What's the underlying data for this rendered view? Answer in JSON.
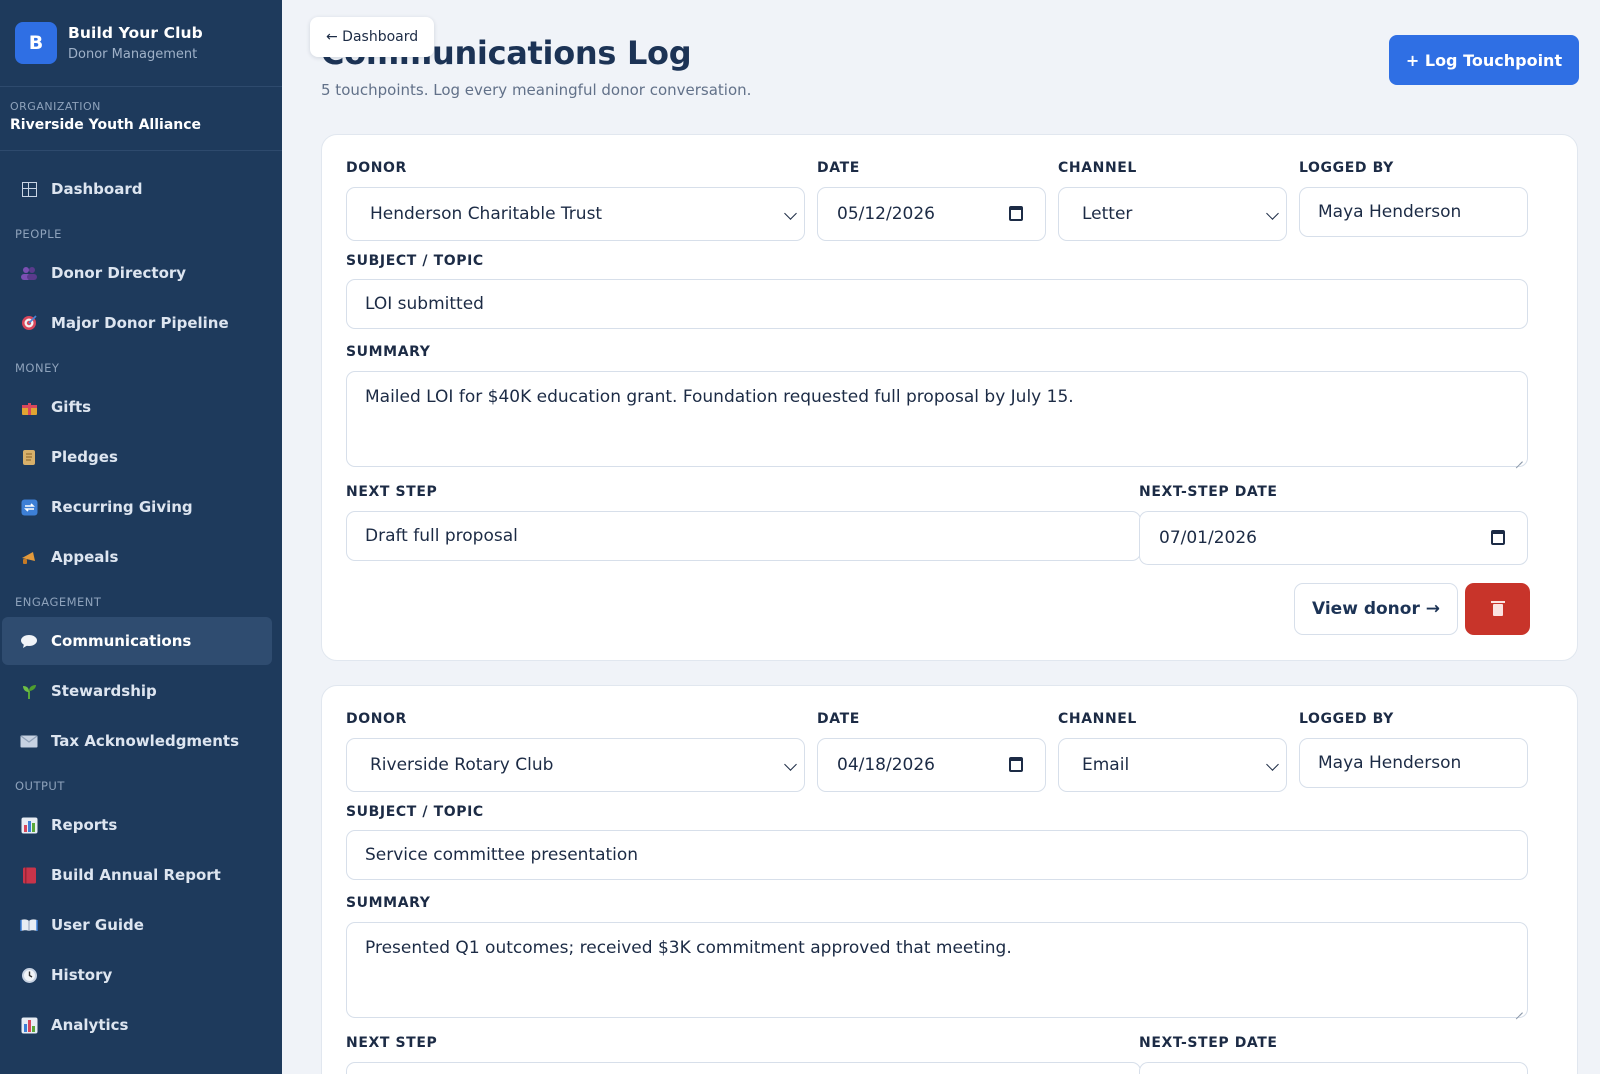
{
  "brand": {
    "logo_letter": "B",
    "title": "Build Your Club",
    "subtitle": "Donor Management"
  },
  "organization": {
    "label": "ORGANIZATION",
    "name": "Riverside Youth Alliance"
  },
  "nav": {
    "dashboard": "Dashboard",
    "section_people": "PEOPLE",
    "donor_directory": "Donor Directory",
    "major_donor_pipeline": "Major Donor Pipeline",
    "section_money": "MONEY",
    "gifts": "Gifts",
    "pledges": "Pledges",
    "recurring_giving": "Recurring Giving",
    "appeals": "Appeals",
    "section_engagement": "ENGAGEMENT",
    "communications": "Communications",
    "stewardship": "Stewardship",
    "tax_acknowledgments": "Tax Acknowledgments",
    "section_output": "OUTPUT",
    "reports": "Reports",
    "build_annual_report": "Build Annual Report",
    "user_guide": "User Guide",
    "history": "History",
    "analytics": "Analytics"
  },
  "header": {
    "back_label": "← Dashboard",
    "title": "Communications Log",
    "subtitle": "5 touchpoints. Log every meaningful donor conversation.",
    "log_button": "+ Log Touchpoint"
  },
  "labels": {
    "donor": "DONOR",
    "date": "DATE",
    "channel": "CHANNEL",
    "logged_by": "LOGGED BY",
    "subject": "SUBJECT / TOPIC",
    "summary": "SUMMARY",
    "next_step": "NEXT STEP",
    "next_step_date": "NEXT-STEP DATE",
    "view_donor": "View donor →"
  },
  "touchpoints": [
    {
      "donor": "Henderson Charitable Trust",
      "date": "05/12/2026",
      "channel": "Letter",
      "logged_by": "Maya Henderson",
      "subject": "LOI submitted",
      "summary": "Mailed LOI for $40K education grant. Foundation requested full proposal by July 15.",
      "next_step": "Draft full proposal",
      "next_step_date": "07/01/2026"
    },
    {
      "donor": "Riverside Rotary Club",
      "date": "04/18/2026",
      "channel": "Email",
      "logged_by": "Maya Henderson",
      "subject": "Service committee presentation",
      "summary": "Presented Q1 outcomes; received $3K commitment approved that meeting."
    }
  ],
  "colors": {
    "sidebar_bg": "#1e3a5c",
    "accent": "#2f6fe4",
    "danger": "#c8342a",
    "page_bg": "#f0f3f8"
  }
}
